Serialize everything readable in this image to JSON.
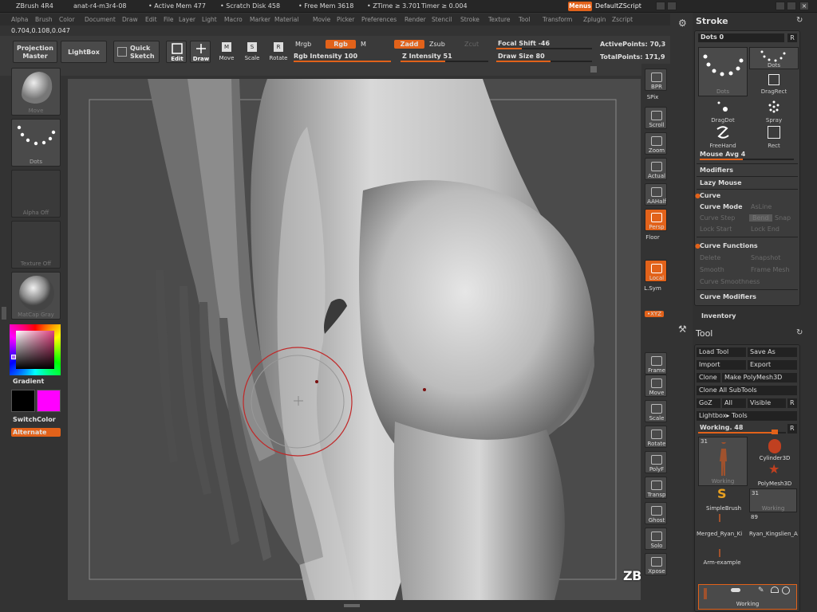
{
  "titlebar": {
    "app": "ZBrush 4R4",
    "project": "anat-r4-m3r4-08",
    "active_mem": "• Active Mem 477",
    "scratch_disk": "• Scratch Disk 458",
    "free_mem": "• Free Mem 3618",
    "ztime": "• ZTime ≥ 3.701",
    "timer": "Timer ≥ 0.004",
    "menus_btn": "Menus",
    "script_btn": "DefaultZScript"
  },
  "menubar": [
    "Alpha",
    "Brush",
    "Color",
    "Document",
    "Draw",
    "Edit",
    "File",
    "Layer",
    "Light",
    "Macro",
    "Marker",
    "Material",
    "Movie",
    "Picker",
    "Preferences",
    "Render",
    "Stencil",
    "Stroke",
    "Texture",
    "Tool",
    "Transform",
    "Zplugin",
    "Zscript"
  ],
  "coords": "0.704,0.108,0.047",
  "shelf": {
    "projection_master": "Projection Master",
    "lightbox": "LightBox",
    "quick_sketch": "Quick Sketch",
    "edit": "Edit",
    "draw": "Draw",
    "move": "Move",
    "scale": "Scale",
    "rotate": "Rotate",
    "mrgb": "Mrgb",
    "rgb": "Rgb",
    "m": "M",
    "rgb_intensity": "Rgb Intensity 100",
    "zadd": "Zadd",
    "zsub": "Zsub",
    "zcut": "Zcut",
    "z_intensity": "Z Intensity 51",
    "focal_shift": "Focal Shift -46",
    "draw_size": "Draw Size 80",
    "active_points": "ActivePoints: 70,3",
    "total_points": "TotalPoints: 171,9",
    "rgb_intensity_value": 100,
    "z_intensity_value": 51,
    "focal_shift_value": -46,
    "draw_size_value": 80
  },
  "left": {
    "brush": "Move",
    "stroke": "Dots",
    "alpha": "Alpha Off",
    "texture": "Texture Off",
    "material": "MatCap Gray",
    "gradient": "Gradient",
    "switchcolor": "SwitchColor",
    "alternate": "Alternate",
    "secondary_color": "#ff00ff"
  },
  "right": [
    {
      "label": "BPR",
      "on": false,
      "icon": "bpr-icon"
    },
    {
      "label": "SPix",
      "on": false,
      "icon": "spix-icon"
    },
    {
      "label": "Scroll",
      "on": false,
      "icon": "scroll-icon"
    },
    {
      "label": "Zoom",
      "on": false,
      "icon": "zoom-icon"
    },
    {
      "label": "Actual",
      "on": false,
      "icon": "actual-icon"
    },
    {
      "label": "AAHalf",
      "on": false,
      "icon": "aahalf-icon"
    },
    {
      "label": "Persp",
      "on": true,
      "icon": "persp-icon"
    },
    {
      "label": "Floor",
      "on": false,
      "icon": "floor-icon"
    },
    {
      "label": "Local",
      "on": true,
      "icon": "local-icon"
    },
    {
      "label": "L.Sym",
      "on": false,
      "icon": "lsym-icon"
    },
    {
      "label": "•XYZ",
      "on": true,
      "icon": "xyz-icon"
    },
    {
      "label": "Frame",
      "on": false,
      "icon": "frame-icon"
    },
    {
      "label": "Move",
      "on": false,
      "icon": "move-icon"
    },
    {
      "label": "Scale",
      "on": false,
      "icon": "scale-icon"
    },
    {
      "label": "Rotate",
      "on": false,
      "icon": "rotate-icon"
    },
    {
      "label": "PolyF",
      "on": false,
      "icon": "polyf-icon"
    },
    {
      "label": "Transp",
      "on": false,
      "icon": "transp-icon"
    },
    {
      "label": "Ghost",
      "on": false,
      "icon": "ghost-icon"
    },
    {
      "label": "Solo",
      "on": false,
      "icon": "solo-icon"
    },
    {
      "label": "Xpose",
      "on": false,
      "icon": "xpose-icon"
    }
  ],
  "stroke_panel": {
    "title": "Stroke",
    "dots": "Dots 0",
    "r": "R",
    "items": [
      "Dots",
      "DragRect",
      "DragDot",
      "Spray",
      "FreeHand",
      "Rect"
    ],
    "mouse_avg": "Mouse Avg 4",
    "modifiers": "Modifiers",
    "lazy_mouse": "Lazy Mouse",
    "curve": "Curve",
    "curve_mode": "Curve Mode",
    "as_line": "AsLine",
    "curve_step": "Curve Step",
    "snap": "Snap",
    "bend": "Bend",
    "lock_start": "Lock Start",
    "lock_end": "Lock End",
    "curve_functions": "Curve Functions",
    "delete": "Delete",
    "snapshot": "Snapshot",
    "smooth": "Smooth",
    "frame_mesh": "Frame Mesh",
    "curve_smoothness": "Curve Smoothness",
    "curve_modifiers": "Curve Modifiers"
  },
  "inventory": "Inventory",
  "tool_panel": {
    "title": "Tool",
    "load_tool": "Load Tool",
    "save_as": "Save As",
    "import": "Import",
    "export": "Export",
    "clone": "Clone",
    "make_polymesh": "Make PolyMesh3D",
    "clone_all": "Clone All SubTools",
    "goz": "GoZ",
    "all": "All",
    "visible": "Visible",
    "r": "R",
    "lightbox_tools": "Lightbox▸ Tools",
    "working": "Working. 48",
    "tools": [
      {
        "name": "Working",
        "count": "31"
      },
      {
        "name": "Cylinder3D",
        "count": ""
      },
      {
        "name": "PolyMesh3D",
        "count": ""
      },
      {
        "name": "SimpleBrush",
        "count": ""
      },
      {
        "name": "Working",
        "count": "31"
      },
      {
        "name": "Merged_Ryan_Ki",
        "count": ""
      },
      {
        "name": "Ryan_Kingslien_A",
        "count": "89"
      },
      {
        "name": "Arm-example",
        "count": ""
      }
    ],
    "subtool_name": "Working"
  },
  "watermark": "ZBRUSH WORKSHOPS"
}
